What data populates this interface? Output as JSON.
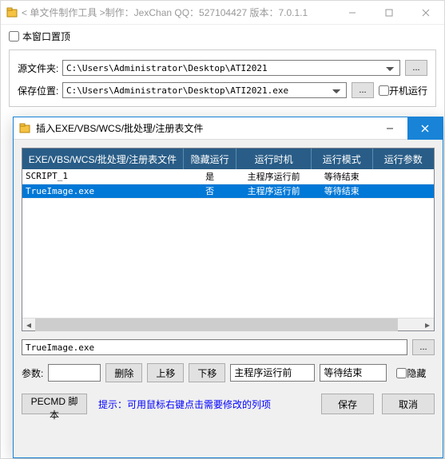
{
  "main": {
    "title": "< 单文件制作工具 >制作：JexChan   QQ：527104427   版本：7.0.1.1",
    "pin_label": "本窗口置顶",
    "src_label": "源文件夹:",
    "src_value": "C:\\Users\\Administrator\\Desktop\\ATI2021",
    "dst_label": "保存位置:",
    "dst_value": "C:\\Users\\Administrator\\Desktop\\ATI2021.exe",
    "browse_label": "...",
    "startup_label": "开机运行"
  },
  "dialog": {
    "title": "插入EXE/VBS/WCS/批处理/注册表文件",
    "columns": [
      "EXE/VBS/WCS/批处理/注册表文件",
      "隐藏运行",
      "运行时机",
      "运行模式",
      "运行参数"
    ],
    "rows": [
      {
        "file": "SCRIPT_1",
        "hidden": "是",
        "timing": "主程序运行前",
        "mode": "等待结束",
        "args": "",
        "selected": false
      },
      {
        "file": "TrueImage.exe",
        "hidden": "否",
        "timing": "主程序运行前",
        "mode": "等待结束",
        "args": "",
        "selected": true
      }
    ],
    "file_value": "TrueImage.exe",
    "params_label": "参数:",
    "params_value": "",
    "btn_delete": "删除",
    "btn_up": "上移",
    "btn_down": "下移",
    "sel_timing": "主程序运行前",
    "sel_mode": "等待结束",
    "chk_hidden": "隐藏",
    "btn_pecmd": "PECMD 脚本",
    "hint": "提示：可用鼠标右键点击需要修改的列项",
    "btn_save": "保存",
    "btn_cancel": "取消"
  }
}
